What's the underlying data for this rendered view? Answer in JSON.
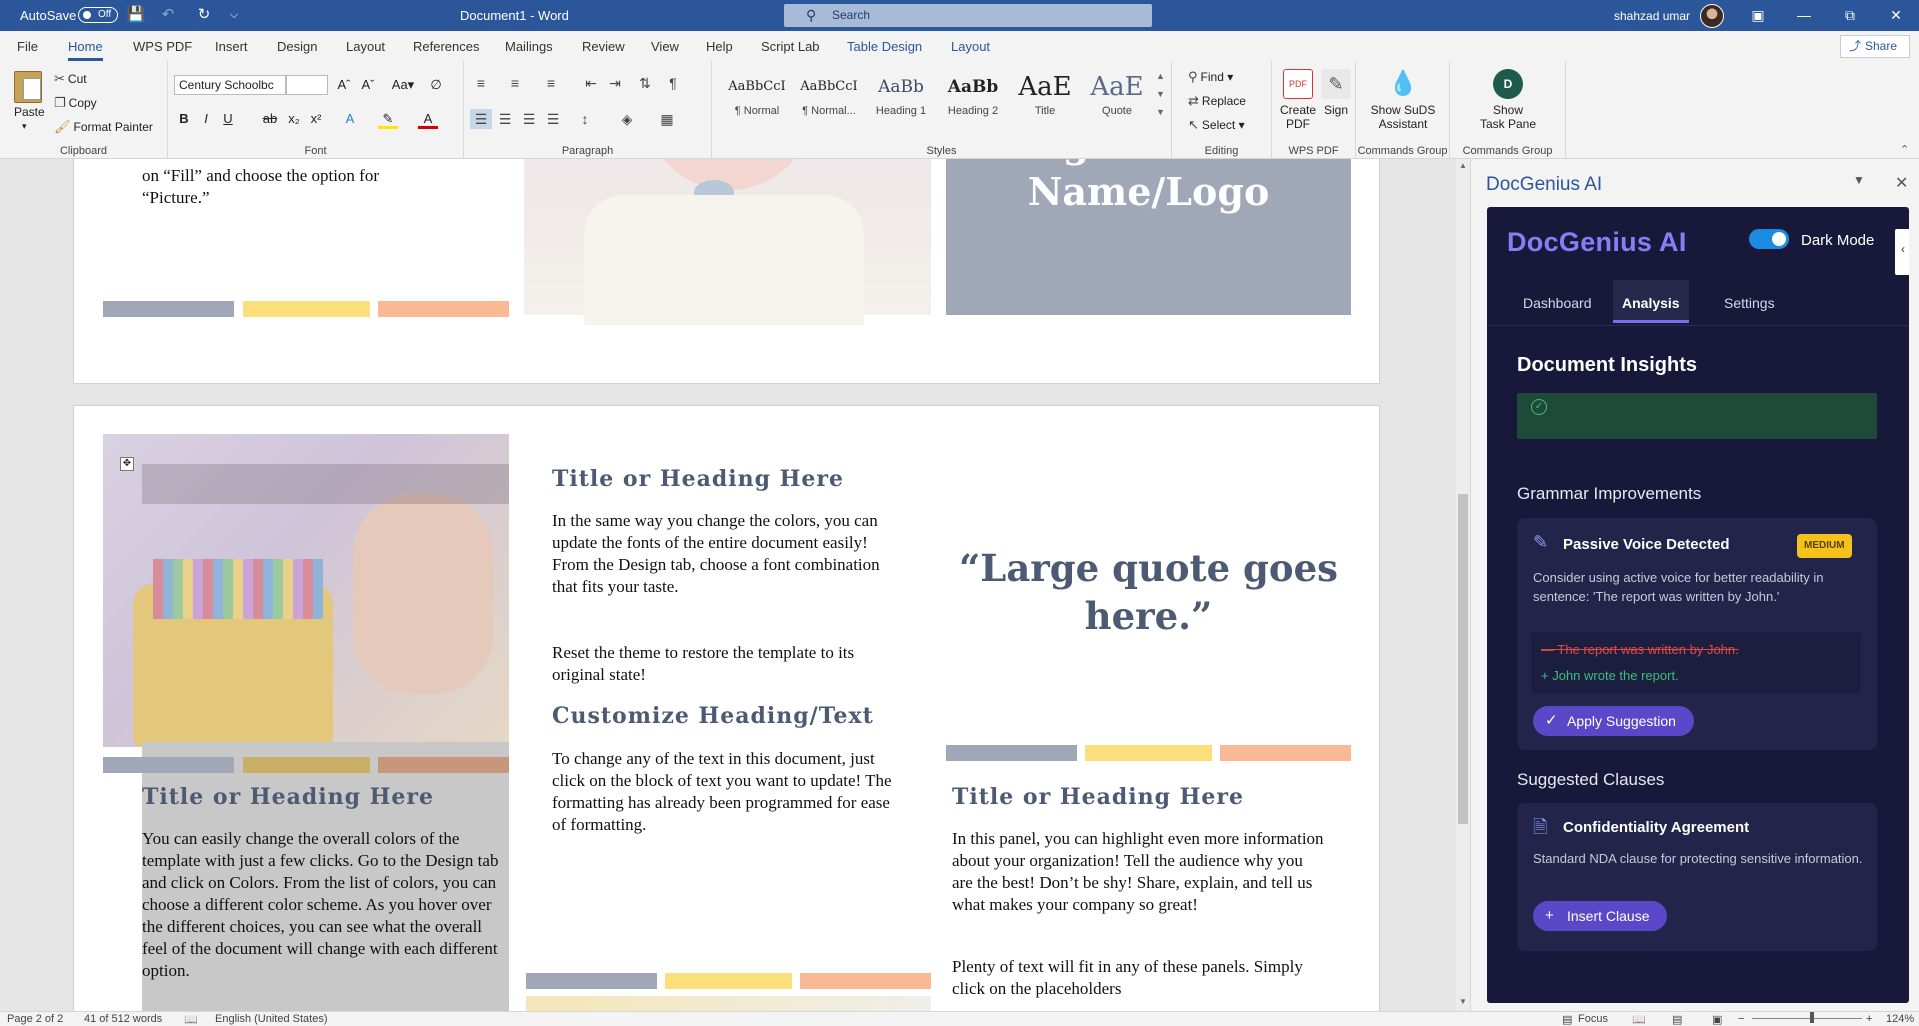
{
  "titlebar": {
    "autosave_label": "AutoSave",
    "autosave_state": "Off",
    "document_title": "Document1 - Word",
    "search_placeholder": "Search",
    "user_name": "shahzad umar"
  },
  "tabs": [
    "File",
    "Home",
    "WPS PDF",
    "Insert",
    "Design",
    "Layout",
    "References",
    "Mailings",
    "Review",
    "View",
    "Help",
    "Script Lab",
    "Table Design",
    "Layout"
  ],
  "share_label": "Share",
  "ribbon": {
    "clipboard": {
      "paste": "Paste",
      "cut": "Cut",
      "copy": "Copy",
      "format_painter": "Format Painter",
      "label": "Clipboard"
    },
    "font": {
      "font_name": "Century Schoolbc",
      "font_size": "",
      "label": "Font"
    },
    "paragraph": {
      "label": "Paragraph"
    },
    "styles": {
      "label": "Styles",
      "items": [
        {
          "preview": "AaBbCcI",
          "name": "¶ Normal"
        },
        {
          "preview": "AaBbCcI",
          "name": "¶ Normal..."
        },
        {
          "preview": "AaBb",
          "name": "Heading 1"
        },
        {
          "preview": "AaBb",
          "name": "Heading 2"
        },
        {
          "preview": "AaE",
          "name": "Title"
        },
        {
          "preview": "AaE",
          "name": "Quote"
        }
      ]
    },
    "editing": {
      "find": "Find",
      "replace": "Replace",
      "select": "Select",
      "label": "Editing"
    },
    "wps": {
      "create_pdf_1": "Create",
      "create_pdf_2": "PDF",
      "sign": "Sign",
      "label": "WPS PDF"
    },
    "commands1": {
      "btn_1": "Show SuDS",
      "btn_2": "Assistant",
      "label": "Commands Group"
    },
    "commands2": {
      "btn_1": "Show",
      "btn_2": "Task Pane",
      "label": "Commands Group"
    }
  },
  "document": {
    "page1": {
      "text_line_1": "on “Fill” and choose the option for",
      "text_line_2": "“Picture.”",
      "org_line_1": "Organization",
      "org_line_2": "Name/Logo"
    },
    "page2": {
      "heading_center": "Title or Heading Here",
      "para_center_1": "In the same way you change the colors, you can update the fonts of the entire document easily!  From the Design tab, choose a font combination that fits your taste.",
      "para_center_2": "Reset the theme to restore the template to its original state!",
      "heading_customize": "Customize Heading/Text",
      "para_center_3": "To change any of the text in this document, just click on the block of text you want to update!  The formatting has already been programmed for ease of formatting.",
      "quote": "“Large quote goes here.”",
      "heading_left": "Title or Heading Here",
      "para_left": "You can easily change the overall colors of the template with just a few clicks.  Go to the Design tab and click on Colors.  From the list of colors, you can choose a different color scheme.  As you hover over the different choices, you can see what the overall feel of the document will change with each different option.",
      "heading_right": "Title or Heading Here",
      "para_right_1": "In this panel, you can highlight even more information about your organization!  Tell the audience why you are the best!  Don’t be shy!  Share, explain, and tell us what makes your company so great!",
      "para_right_2": "Plenty of text will fit in any of these panels.  Simply click on the placeholders"
    },
    "colors": {
      "gray": "#a0a8b8",
      "yellow": "#fcdf7b",
      "peach": "#f9b994"
    }
  },
  "pane": {
    "title": "DocGenius AI",
    "brand": "DocGenius AI",
    "dark_mode_label": "Dark Mode",
    "tabs": [
      "Dashboard",
      "Analysis",
      "Settings"
    ],
    "insights_title": "Document Insights",
    "grammar_title": "Grammar Improvements",
    "grammar_card": {
      "title": "Passive Voice Detected",
      "badge": "MEDIUM",
      "desc": "Consider using active voice for better readability in sentence: 'The report was written by John.'",
      "removed": "The report was written by John.",
      "added": "John wrote the report.",
      "button": "Apply Suggestion"
    },
    "clauses_title": "Suggested Clauses",
    "clause_card": {
      "title": "Confidentiality Agreement",
      "desc": "Standard NDA clause for protecting sensitive information.",
      "button": "Insert Clause"
    }
  },
  "status": {
    "page": "Page 2 of 2",
    "words": "41 of 512 words",
    "language": "English (United States)",
    "focus": "Focus",
    "zoom": "124%"
  }
}
